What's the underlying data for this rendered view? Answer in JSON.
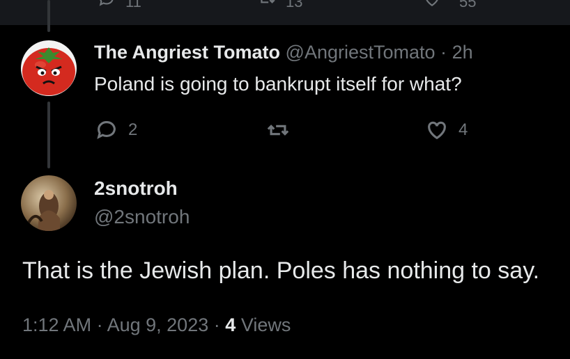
{
  "previous_tweet": {
    "reply_count": "11",
    "retweet_count": "13",
    "like_count": "55"
  },
  "reply": {
    "display_name": "The Angriest Tomato",
    "handle": "@AngriestTomato",
    "separator": "·",
    "time_ago": "2h",
    "text": "Poland is going to bankrupt itself for what?",
    "reply_count": "2",
    "like_count": "4"
  },
  "main_tweet": {
    "display_name": "2snotroh",
    "handle": "@2snotroh",
    "text": "That is the Jewish plan. Poles has nothing to say.",
    "time": "1:12 AM",
    "separator": "·",
    "date": "Aug 9, 2023",
    "views_count": "4",
    "views_label": "Views"
  },
  "colors": {
    "background": "#000000",
    "text_primary": "#e7e9ea",
    "text_secondary": "#71767b",
    "thread_line": "#333639"
  }
}
